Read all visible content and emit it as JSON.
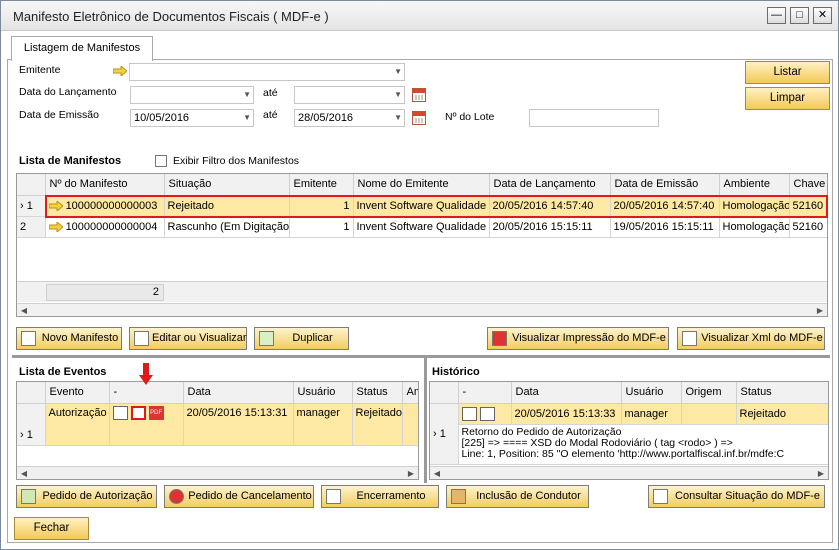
{
  "window": {
    "title": "Manifesto Eletrônico de Documentos Fiscais (  MDF-e )",
    "controls": {
      "minimize": "—",
      "maximize": "□",
      "close": "✕"
    }
  },
  "tabs": [
    {
      "label": "Listagem de Manifestos"
    }
  ],
  "filters": {
    "emitente_label": "Emitente",
    "emitente_value": "",
    "data_lancamento_label": "Data do Lançamento",
    "data_lancamento_from": "",
    "ate_label": "até",
    "data_lancamento_to": "",
    "data_emissao_label": "Data de Emissão",
    "data_emissao_from": "10/05/2016",
    "data_emissao_to": "28/05/2016",
    "lote_label": "Nº do Lote",
    "lote_value": ""
  },
  "actions": {
    "listar": "Listar",
    "limpar": "Limpar"
  },
  "manifestos": {
    "title": "Lista de Manifestos",
    "exibir_filtro_label": "Exibir Filtro dos Manifestos",
    "columns": [
      "Nº do Manifesto",
      "Situação",
      "Emitente",
      "Nome do Emitente",
      "Data de Lançamento",
      "Data de Emissão",
      "Ambiente",
      "Chave"
    ],
    "rows": [
      {
        "idx": "1",
        "numero": "100000000000003",
        "situacao": "Rejeitado",
        "emitente": "1",
        "nome": "Invent Software Qualidade",
        "lancamento": "20/05/2016 14:57:40",
        "emissao": "20/05/2016 14:57:40",
        "ambiente": "Homologação",
        "chave": "52160"
      },
      {
        "idx": "2",
        "numero": "100000000000004",
        "situacao": "Rascunho (Em Digitação)",
        "emitente": "1",
        "nome": "Invent Software Qualidade",
        "lancamento": "20/05/2016 15:15:11",
        "emissao": "19/05/2016 15:15:11",
        "ambiente": "Homologação",
        "chave": "52160"
      }
    ],
    "total": "2"
  },
  "manifesto_buttons": {
    "novo": "Novo Manifesto",
    "editar": "Editar ou Visualizar",
    "duplicar": "Duplicar",
    "visualizar_impressao": "Visualizar Impressão do MDF-e",
    "visualizar_xml": "Visualizar Xml do MDF-e"
  },
  "eventos": {
    "title": "Lista de Eventos",
    "columns": [
      "Evento",
      "-",
      "Data",
      "Usuário",
      "Status",
      "Am"
    ],
    "rows": [
      {
        "idx": "1",
        "evento": "Autorização",
        "data": "20/05/2016 15:13:31",
        "usuario": "manager",
        "status": "Rejeitado"
      }
    ]
  },
  "historico": {
    "title": "Histórico",
    "columns": [
      "-",
      "Data",
      "Usuário",
      "Origem",
      "Status"
    ],
    "rows": [
      {
        "idx": "1",
        "data": "20/05/2016 15:13:33",
        "usuario": "manager",
        "origem": "",
        "status": "Rejeitado"
      }
    ],
    "detail_lines": [
      "Retorno do Pedido de Autorização",
      "[225] => ==== XSD do Modal Rodoviário ( tag <rodo> ) =>",
      "Line: 1, Position: 85 \"O elemento 'http://www.portalfiscal.inf.br/mdfe:C"
    ]
  },
  "event_buttons": {
    "pedido_autorizacao": "Pedido de Autorização",
    "pedido_cancelamento": "Pedido de Cancelamento",
    "encerramento": "Encerramento",
    "inclusao_condutor": "Inclusão de Condutor",
    "consultar_situacao": "Consultar Situação do MDF-e"
  },
  "footer": {
    "fechar": "Fechar"
  },
  "colors": {
    "accent_yellow": "#f3c958",
    "selected_row": "#fde9a3",
    "highlight_red": "#e01a1a"
  }
}
